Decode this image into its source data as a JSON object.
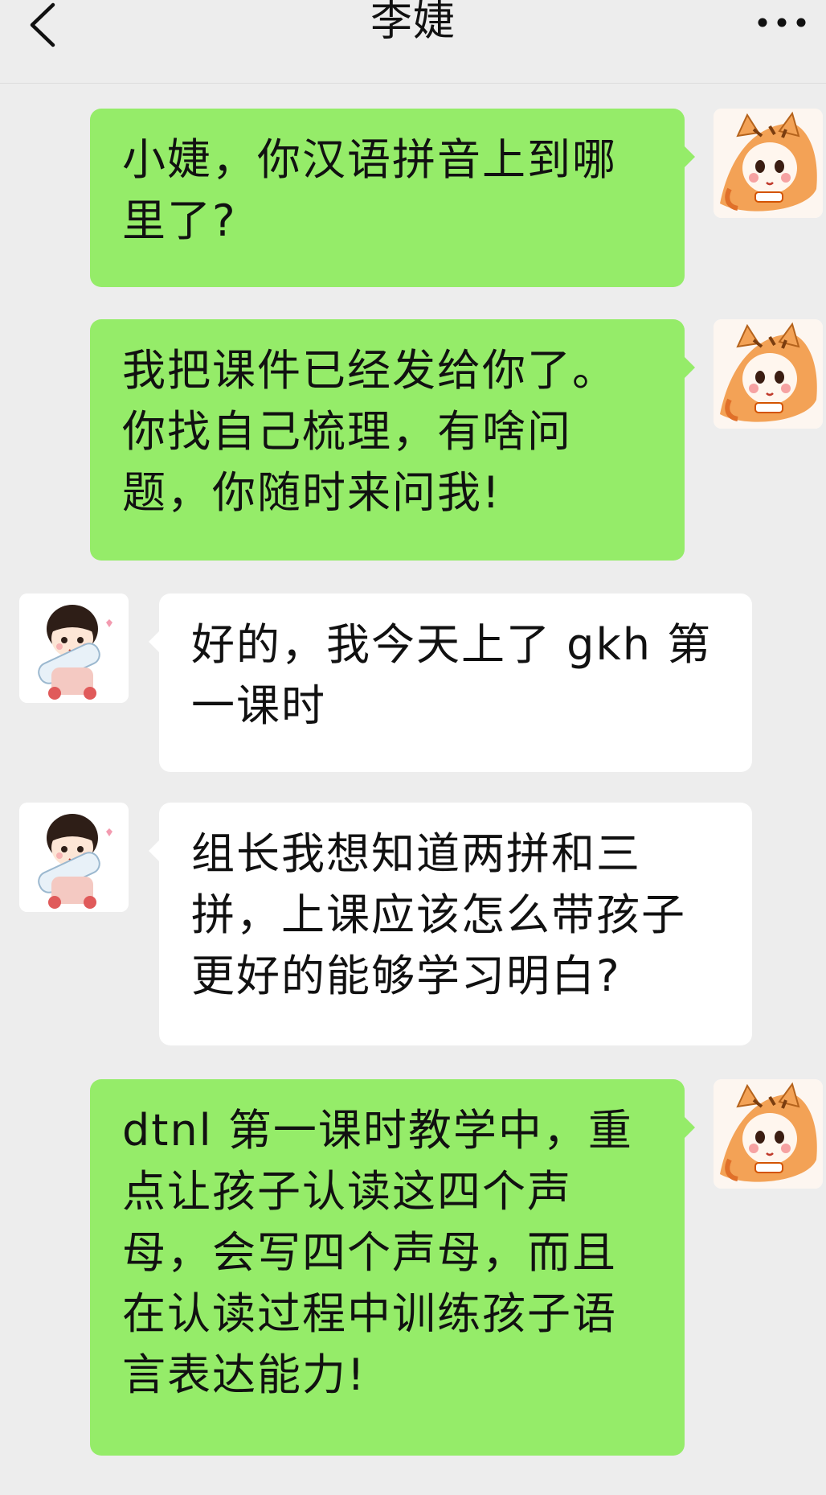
{
  "header": {
    "title": "李婕",
    "back_icon": "chevron-left-icon",
    "more_icon": "more-dots-icon"
  },
  "avatars": {
    "me": "tiger-costume-girl-avatar",
    "them": "girl-holding-bottle-avatar"
  },
  "messages": [
    {
      "sender": "me",
      "text": "小婕，你汉语拼音上到哪里了?"
    },
    {
      "sender": "me",
      "text": "我把课件已经发给你了。你找自己梳理，有啥问题，你随时来问我!"
    },
    {
      "sender": "them",
      "text": "好的，我今天上了 gkh 第一课时"
    },
    {
      "sender": "them",
      "text": "组长我想知道两拼和三拼，上课应该怎么带孩子更好的能够学习明白?"
    },
    {
      "sender": "me",
      "text": "dtnl 第一课时教学中，重点让孩子认读这四个声母，会写四个声母，而且在认读过程中训练孩子语言表达能力!"
    }
  ],
  "colors": {
    "background": "#ededed",
    "my_bubble": "#95ec69",
    "their_bubble": "#ffffff"
  }
}
